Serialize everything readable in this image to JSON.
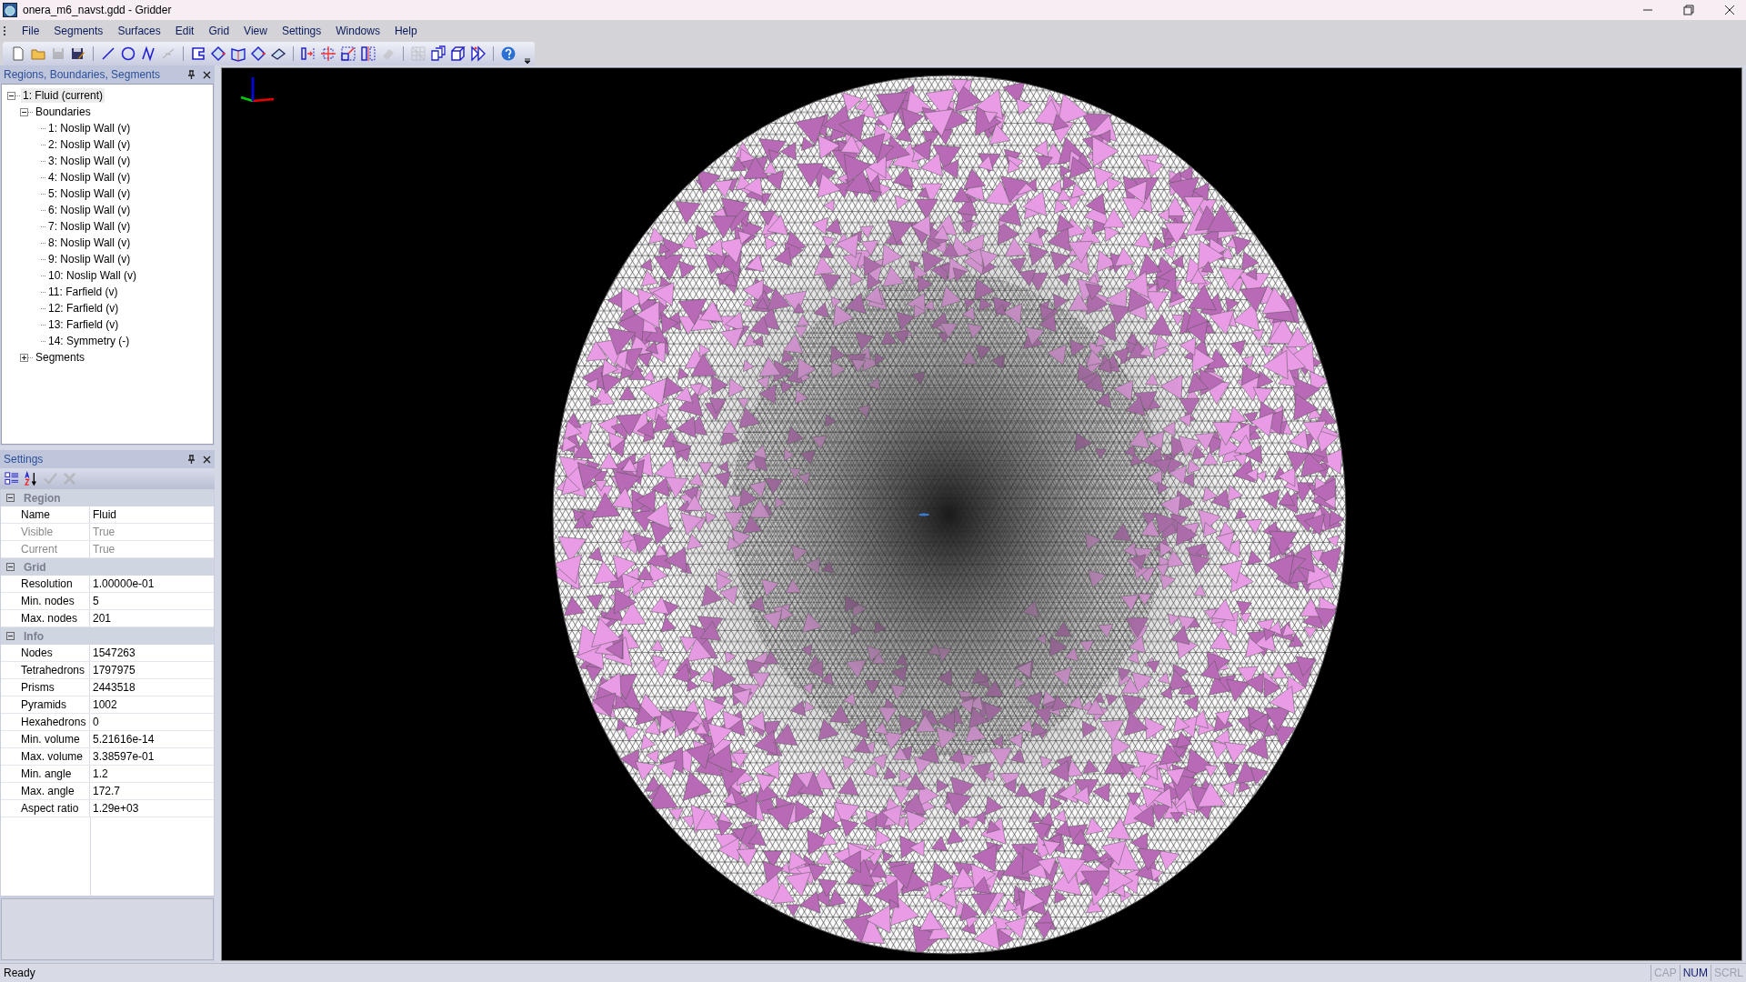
{
  "window": {
    "title": "onera_m6_navst.gdd - Gridder"
  },
  "menu": [
    "File",
    "Segments",
    "Surfaces",
    "Edit",
    "Grid",
    "View",
    "Settings",
    "Windows",
    "Help"
  ],
  "toolbar": [
    {
      "kind": "new",
      "disabled": false
    },
    {
      "kind": "open",
      "disabled": false
    },
    {
      "kind": "save",
      "disabled": true
    },
    {
      "kind": "export",
      "disabled": false
    },
    {
      "kind": "sep"
    },
    {
      "kind": "line",
      "disabled": false
    },
    {
      "kind": "circle",
      "disabled": false
    },
    {
      "kind": "curve",
      "disabled": false
    },
    {
      "kind": "trim",
      "disabled": true
    },
    {
      "kind": "sep"
    },
    {
      "kind": "rect",
      "disabled": false
    },
    {
      "kind": "diamond",
      "disabled": false
    },
    {
      "kind": "book",
      "disabled": false
    },
    {
      "kind": "diamond",
      "disabled": false
    },
    {
      "kind": "plane",
      "disabled": false
    },
    {
      "kind": "sep"
    },
    {
      "kind": "bracket",
      "disabled": false
    },
    {
      "kind": "move",
      "disabled": false
    },
    {
      "kind": "scale",
      "disabled": false
    },
    {
      "kind": "mirror",
      "disabled": false
    },
    {
      "kind": "eraser",
      "disabled": true
    },
    {
      "kind": "sep"
    },
    {
      "kind": "grid",
      "disabled": true
    },
    {
      "kind": "cubes",
      "disabled": false
    },
    {
      "kind": "cube",
      "disabled": false
    },
    {
      "kind": "play",
      "disabled": false
    },
    {
      "kind": "sep"
    },
    {
      "kind": "help",
      "disabled": false
    }
  ],
  "tree_panel": {
    "title": "Regions, Boundaries, Segments",
    "items": [
      {
        "label": "1: Fluid (current)",
        "selected": true,
        "expanded": true,
        "children": [
          {
            "label": "Boundaries",
            "selected": false,
            "expanded": true,
            "children": [
              {
                "label": "1: Noslip Wall (v)",
                "selected": false
              },
              {
                "label": "2: Noslip Wall (v)",
                "selected": false
              },
              {
                "label": "3: Noslip Wall (v)",
                "selected": false
              },
              {
                "label": "4: Noslip Wall (v)",
                "selected": false
              },
              {
                "label": "5: Noslip Wall (v)",
                "selected": false
              },
              {
                "label": "6: Noslip Wall (v)",
                "selected": false
              },
              {
                "label": "7: Noslip Wall (v)",
                "selected": false
              },
              {
                "label": "8: Noslip Wall (v)",
                "selected": false
              },
              {
                "label": "9: Noslip Wall (v)",
                "selected": false
              },
              {
                "label": "10: Noslip Wall (v)",
                "selected": false
              },
              {
                "label": "11: Farfield (v)",
                "selected": false
              },
              {
                "label": "12: Farfield (v)",
                "selected": false
              },
              {
                "label": "13: Farfield (v)",
                "selected": false
              },
              {
                "label": "14: Symmetry (-)",
                "selected": false
              }
            ]
          },
          {
            "label": "Segments",
            "selected": false,
            "expanded": false
          }
        ]
      }
    ]
  },
  "settings_panel": {
    "title": "Settings",
    "tools": [
      {
        "kind": "categorized",
        "disabled": false
      },
      {
        "kind": "alphabetical",
        "disabled": false
      },
      {
        "kind": "apply",
        "disabled": true
      },
      {
        "kind": "cancel",
        "disabled": true
      }
    ],
    "categories": [
      {
        "name": "Region",
        "expanded": true,
        "properties": [
          {
            "name": "Name",
            "value": "Fluid",
            "disabled": false
          },
          {
            "name": "Visible",
            "value": "True",
            "disabled": true
          },
          {
            "name": "Current",
            "value": "True",
            "disabled": true
          }
        ]
      },
      {
        "name": "Grid",
        "expanded": true,
        "properties": [
          {
            "name": "Resolution",
            "value": "1.00000e-01",
            "disabled": false
          },
          {
            "name": "Min. nodes",
            "value": "5",
            "disabled": false
          },
          {
            "name": "Max. nodes",
            "value": "201",
            "disabled": false
          }
        ]
      },
      {
        "name": "Info",
        "expanded": true,
        "properties": [
          {
            "name": "Nodes",
            "value": "1547263",
            "disabled": false
          },
          {
            "name": "Tetrahedrons",
            "value": "1797975",
            "disabled": false
          },
          {
            "name": "Prisms",
            "value": "2443518",
            "disabled": false
          },
          {
            "name": "Pyramids",
            "value": "1002",
            "disabled": false
          },
          {
            "name": "Hexahedrons",
            "value": "0",
            "disabled": false
          },
          {
            "name": "Min. volume",
            "value": "5.21616e-14",
            "disabled": false
          },
          {
            "name": "Max. volume",
            "value": "3.38597e-01",
            "disabled": false
          },
          {
            "name": "Min. angle",
            "value": "1.2",
            "disabled": false
          },
          {
            "name": "Max. angle",
            "value": "172.7",
            "disabled": false
          },
          {
            "name": "Aspect ratio",
            "value": "1.29e+03",
            "disabled": false
          }
        ]
      }
    ]
  },
  "status_bar": {
    "text": "Ready",
    "indicators": [
      {
        "label": "CAP",
        "on": false
      },
      {
        "label": "NUM",
        "on": true
      },
      {
        "label": "SCRL",
        "on": false
      }
    ]
  }
}
